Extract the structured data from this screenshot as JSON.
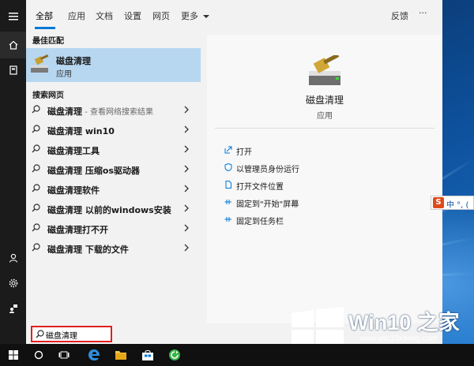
{
  "tabs": [
    {
      "label": "全部",
      "active": true
    },
    {
      "label": "应用"
    },
    {
      "label": "文档"
    },
    {
      "label": "设置"
    },
    {
      "label": "网页"
    },
    {
      "label": "更多"
    }
  ],
  "feedback_label": "反馈",
  "more_options_label": "···",
  "best_match": {
    "heading": "最佳匹配",
    "title": "磁盘清理",
    "subtitle": "应用"
  },
  "web_search": {
    "heading": "搜索网页",
    "items": [
      {
        "bold": "磁盘清理",
        "rest": " - 查看网络搜索结果"
      },
      {
        "bold": "磁盘清理 win10",
        "rest": ""
      },
      {
        "bold": "磁盘清理工具",
        "rest": ""
      },
      {
        "bold": "磁盘清理 压缩os驱动器",
        "rest": ""
      },
      {
        "bold": "磁盘清理软件",
        "rest": ""
      },
      {
        "bold": "磁盘清理 以前的windows安装",
        "rest": ""
      },
      {
        "bold": "磁盘清理打不开",
        "rest": ""
      },
      {
        "bold": "磁盘清理 下载的文件",
        "rest": ""
      }
    ]
  },
  "detail": {
    "name": "磁盘清理",
    "kind": "应用",
    "actions": [
      {
        "label": "打开",
        "icon": "open-icon"
      },
      {
        "label": "以管理员身份运行",
        "icon": "shield-icon"
      },
      {
        "label": "打开文件位置",
        "icon": "file-icon"
      },
      {
        "label": "固定到\"开始\"屏幕",
        "icon": "pin-icon"
      },
      {
        "label": "固定到任务栏",
        "icon": "pin-icon"
      }
    ]
  },
  "search": {
    "value": "磁盘清理"
  },
  "ime": {
    "logo": "S",
    "text": "中 °, ("
  },
  "watermark": {
    "brand": "Win10 之家",
    "url": "www.win10xitong.com"
  },
  "colors": {
    "accent": "#0078d7",
    "highlight": "#b7d7f1",
    "search_border": "#e02020"
  }
}
